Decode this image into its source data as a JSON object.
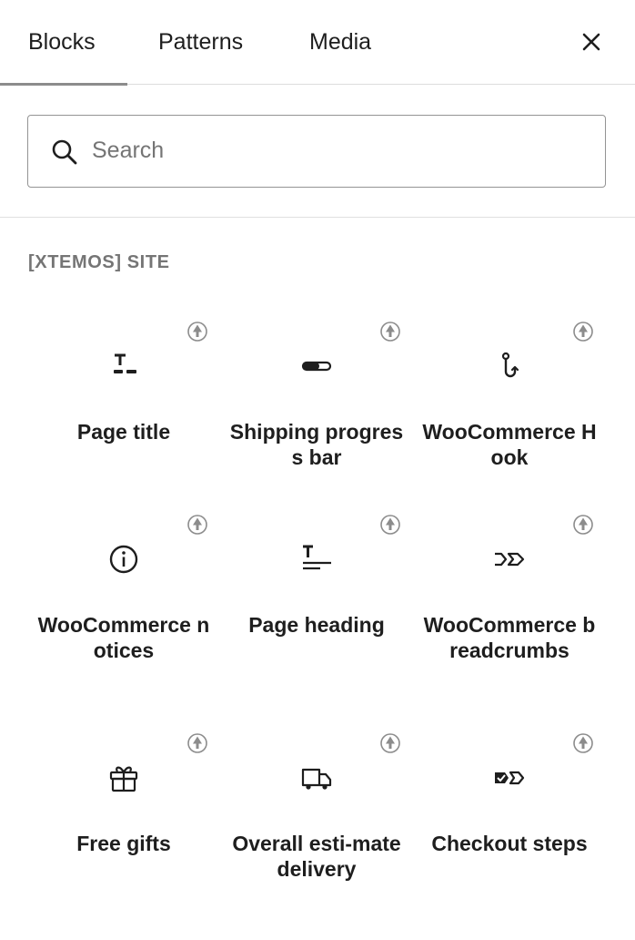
{
  "tabs": [
    {
      "label": "Blocks",
      "active": true
    },
    {
      "label": "Patterns",
      "active": false
    },
    {
      "label": "Media",
      "active": false
    }
  ],
  "close_icon": "close-icon",
  "search": {
    "placeholder": "Search",
    "value": ""
  },
  "category": {
    "title": "[XTEMOS] SITE"
  },
  "blocks": [
    {
      "label": "Page title",
      "icon": "page-title-icon",
      "badge": "premium-tree-icon"
    },
    {
      "label": "Shipping progress bar",
      "icon": "progress-bar-icon",
      "badge": "premium-tree-icon"
    },
    {
      "label": "WooCommerce Hook",
      "icon": "hook-icon",
      "badge": "premium-tree-icon"
    },
    {
      "label": "WooCommerce notices",
      "icon": "info-icon",
      "badge": "premium-tree-icon"
    },
    {
      "label": "Page heading",
      "icon": "page-heading-icon",
      "badge": "premium-tree-icon"
    },
    {
      "label": "WooCommerce breadcrumbs",
      "icon": "breadcrumbs-icon",
      "badge": "premium-tree-icon"
    },
    {
      "label": "Free gifts",
      "icon": "gift-icon",
      "badge": "premium-tree-icon"
    },
    {
      "label": "Overall esti-mate delivery",
      "icon": "truck-icon",
      "badge": "premium-tree-icon"
    },
    {
      "label": "Checkout steps",
      "icon": "checkout-steps-icon",
      "badge": "premium-tree-icon"
    }
  ],
  "colors": {
    "text": "#1e1e1e",
    "muted": "#757575",
    "badge": "#8c8c8c",
    "border": "#949494"
  }
}
